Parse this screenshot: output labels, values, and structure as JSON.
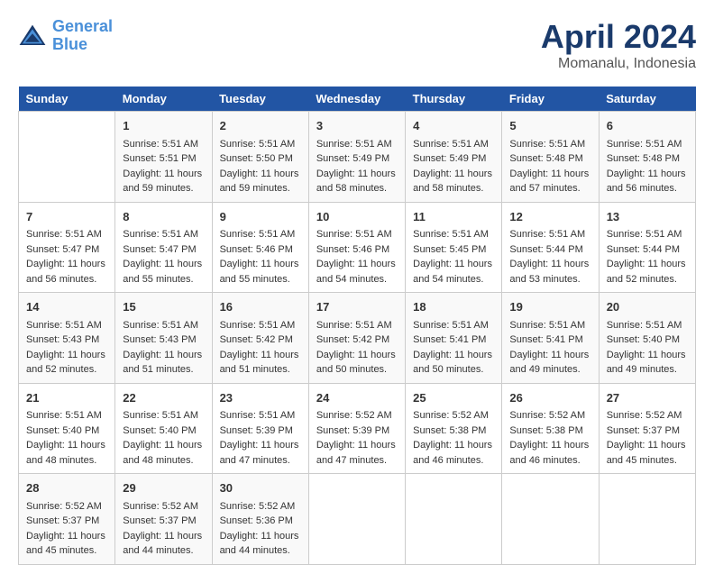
{
  "header": {
    "logo_line1": "General",
    "logo_line2": "Blue",
    "title": "April 2024",
    "subtitle": "Momanalu, Indonesia"
  },
  "calendar": {
    "days_of_week": [
      "Sunday",
      "Monday",
      "Tuesday",
      "Wednesday",
      "Thursday",
      "Friday",
      "Saturday"
    ],
    "weeks": [
      [
        {
          "day": "",
          "content": ""
        },
        {
          "day": "1",
          "content": "Sunrise: 5:51 AM\nSunset: 5:51 PM\nDaylight: 11 hours\nand 59 minutes."
        },
        {
          "day": "2",
          "content": "Sunrise: 5:51 AM\nSunset: 5:50 PM\nDaylight: 11 hours\nand 59 minutes."
        },
        {
          "day": "3",
          "content": "Sunrise: 5:51 AM\nSunset: 5:49 PM\nDaylight: 11 hours\nand 58 minutes."
        },
        {
          "day": "4",
          "content": "Sunrise: 5:51 AM\nSunset: 5:49 PM\nDaylight: 11 hours\nand 58 minutes."
        },
        {
          "day": "5",
          "content": "Sunrise: 5:51 AM\nSunset: 5:48 PM\nDaylight: 11 hours\nand 57 minutes."
        },
        {
          "day": "6",
          "content": "Sunrise: 5:51 AM\nSunset: 5:48 PM\nDaylight: 11 hours\nand 56 minutes."
        }
      ],
      [
        {
          "day": "7",
          "content": "Sunrise: 5:51 AM\nSunset: 5:47 PM\nDaylight: 11 hours\nand 56 minutes."
        },
        {
          "day": "8",
          "content": "Sunrise: 5:51 AM\nSunset: 5:47 PM\nDaylight: 11 hours\nand 55 minutes."
        },
        {
          "day": "9",
          "content": "Sunrise: 5:51 AM\nSunset: 5:46 PM\nDaylight: 11 hours\nand 55 minutes."
        },
        {
          "day": "10",
          "content": "Sunrise: 5:51 AM\nSunset: 5:46 PM\nDaylight: 11 hours\nand 54 minutes."
        },
        {
          "day": "11",
          "content": "Sunrise: 5:51 AM\nSunset: 5:45 PM\nDaylight: 11 hours\nand 54 minutes."
        },
        {
          "day": "12",
          "content": "Sunrise: 5:51 AM\nSunset: 5:44 PM\nDaylight: 11 hours\nand 53 minutes."
        },
        {
          "day": "13",
          "content": "Sunrise: 5:51 AM\nSunset: 5:44 PM\nDaylight: 11 hours\nand 52 minutes."
        }
      ],
      [
        {
          "day": "14",
          "content": "Sunrise: 5:51 AM\nSunset: 5:43 PM\nDaylight: 11 hours\nand 52 minutes."
        },
        {
          "day": "15",
          "content": "Sunrise: 5:51 AM\nSunset: 5:43 PM\nDaylight: 11 hours\nand 51 minutes."
        },
        {
          "day": "16",
          "content": "Sunrise: 5:51 AM\nSunset: 5:42 PM\nDaylight: 11 hours\nand 51 minutes."
        },
        {
          "day": "17",
          "content": "Sunrise: 5:51 AM\nSunset: 5:42 PM\nDaylight: 11 hours\nand 50 minutes."
        },
        {
          "day": "18",
          "content": "Sunrise: 5:51 AM\nSunset: 5:41 PM\nDaylight: 11 hours\nand 50 minutes."
        },
        {
          "day": "19",
          "content": "Sunrise: 5:51 AM\nSunset: 5:41 PM\nDaylight: 11 hours\nand 49 minutes."
        },
        {
          "day": "20",
          "content": "Sunrise: 5:51 AM\nSunset: 5:40 PM\nDaylight: 11 hours\nand 49 minutes."
        }
      ],
      [
        {
          "day": "21",
          "content": "Sunrise: 5:51 AM\nSunset: 5:40 PM\nDaylight: 11 hours\nand 48 minutes."
        },
        {
          "day": "22",
          "content": "Sunrise: 5:51 AM\nSunset: 5:40 PM\nDaylight: 11 hours\nand 48 minutes."
        },
        {
          "day": "23",
          "content": "Sunrise: 5:51 AM\nSunset: 5:39 PM\nDaylight: 11 hours\nand 47 minutes."
        },
        {
          "day": "24",
          "content": "Sunrise: 5:52 AM\nSunset: 5:39 PM\nDaylight: 11 hours\nand 47 minutes."
        },
        {
          "day": "25",
          "content": "Sunrise: 5:52 AM\nSunset: 5:38 PM\nDaylight: 11 hours\nand 46 minutes."
        },
        {
          "day": "26",
          "content": "Sunrise: 5:52 AM\nSunset: 5:38 PM\nDaylight: 11 hours\nand 46 minutes."
        },
        {
          "day": "27",
          "content": "Sunrise: 5:52 AM\nSunset: 5:37 PM\nDaylight: 11 hours\nand 45 minutes."
        }
      ],
      [
        {
          "day": "28",
          "content": "Sunrise: 5:52 AM\nSunset: 5:37 PM\nDaylight: 11 hours\nand 45 minutes."
        },
        {
          "day": "29",
          "content": "Sunrise: 5:52 AM\nSunset: 5:37 PM\nDaylight: 11 hours\nand 44 minutes."
        },
        {
          "day": "30",
          "content": "Sunrise: 5:52 AM\nSunset: 5:36 PM\nDaylight: 11 hours\nand 44 minutes."
        },
        {
          "day": "",
          "content": ""
        },
        {
          "day": "",
          "content": ""
        },
        {
          "day": "",
          "content": ""
        },
        {
          "day": "",
          "content": ""
        }
      ]
    ]
  }
}
